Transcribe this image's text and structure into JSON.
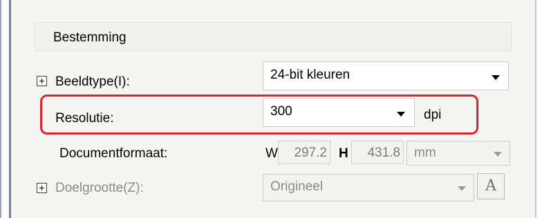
{
  "section": {
    "title": "Bestemming"
  },
  "image_type": {
    "label": "Beeldtype(I):",
    "value": "24-bit kleuren"
  },
  "resolution": {
    "label": "Resolutie:",
    "value": "300",
    "unit": "dpi"
  },
  "document_size": {
    "label": "Documentformaat:",
    "w_label": "W",
    "w_value": "297.2",
    "h_label": "H",
    "h_value": "431.8",
    "unit": "mm"
  },
  "target_size": {
    "label": "Doelgrootte(Z):",
    "value": "Origineel",
    "button_glyph": "A"
  },
  "colors": {
    "highlight": "#e0222a",
    "panel": "#f5f5f1"
  },
  "icons": [
    "plus-expander-icon",
    "dropdown-caret-icon"
  ]
}
